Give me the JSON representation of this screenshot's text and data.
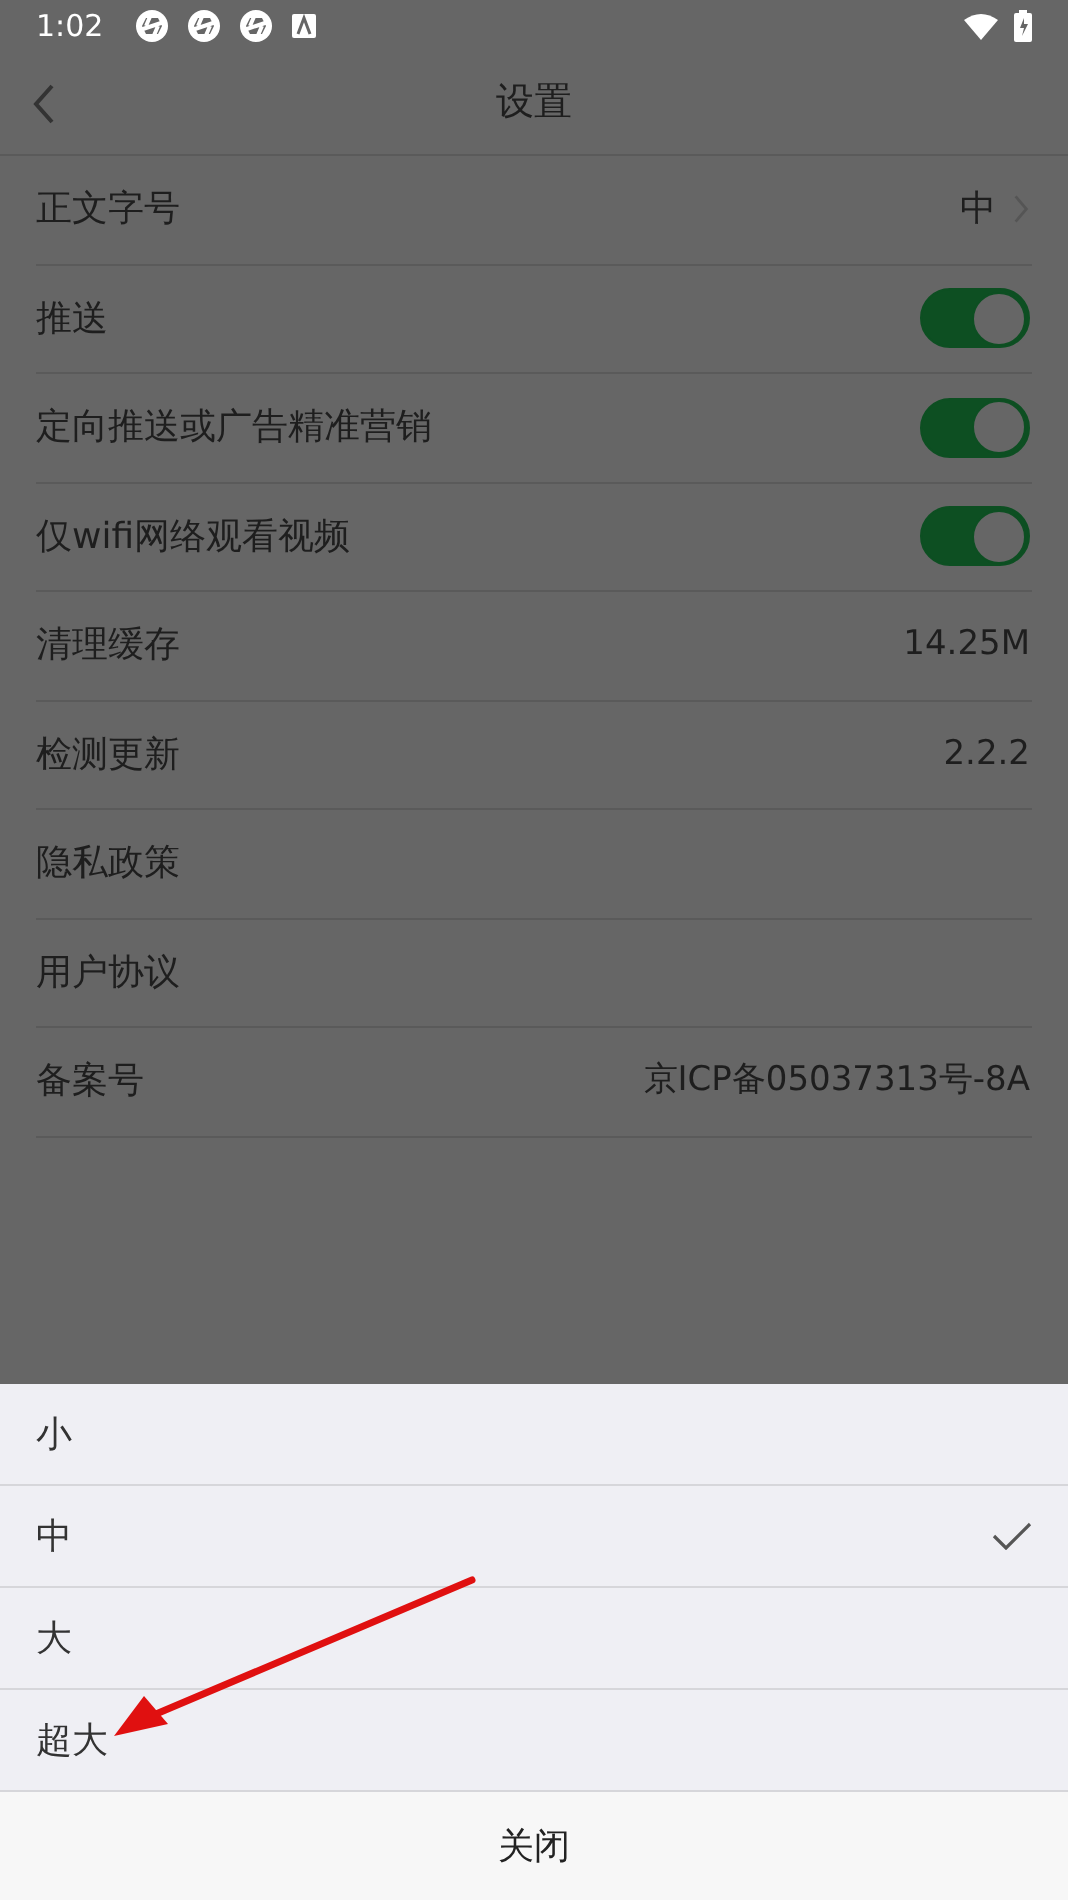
{
  "status_bar": {
    "time": "1:02"
  },
  "header": {
    "title": "设置"
  },
  "settings": [
    {
      "kind": "link",
      "label": "正文字号",
      "value": "中"
    },
    {
      "kind": "switch",
      "label": "推送",
      "on": true
    },
    {
      "kind": "switch",
      "label": "定向推送或广告精准营销",
      "on": true
    },
    {
      "kind": "switch",
      "label": "仅wifi网络观看视频",
      "on": true
    },
    {
      "kind": "value",
      "label": "清理缓存",
      "value": "14.25M"
    },
    {
      "kind": "value",
      "label": "检测更新",
      "value": "2.2.2"
    },
    {
      "kind": "plain",
      "label": "隐私政策"
    },
    {
      "kind": "plain",
      "label": "用户协议"
    },
    {
      "kind": "value",
      "label": "备案号",
      "value": "京ICP备05037313号-8A"
    }
  ],
  "sheet": {
    "options": [
      {
        "label": "小",
        "selected": false
      },
      {
        "label": "中",
        "selected": true
      },
      {
        "label": "大",
        "selected": false
      },
      {
        "label": "超大",
        "selected": false
      }
    ],
    "close": "关闭"
  }
}
